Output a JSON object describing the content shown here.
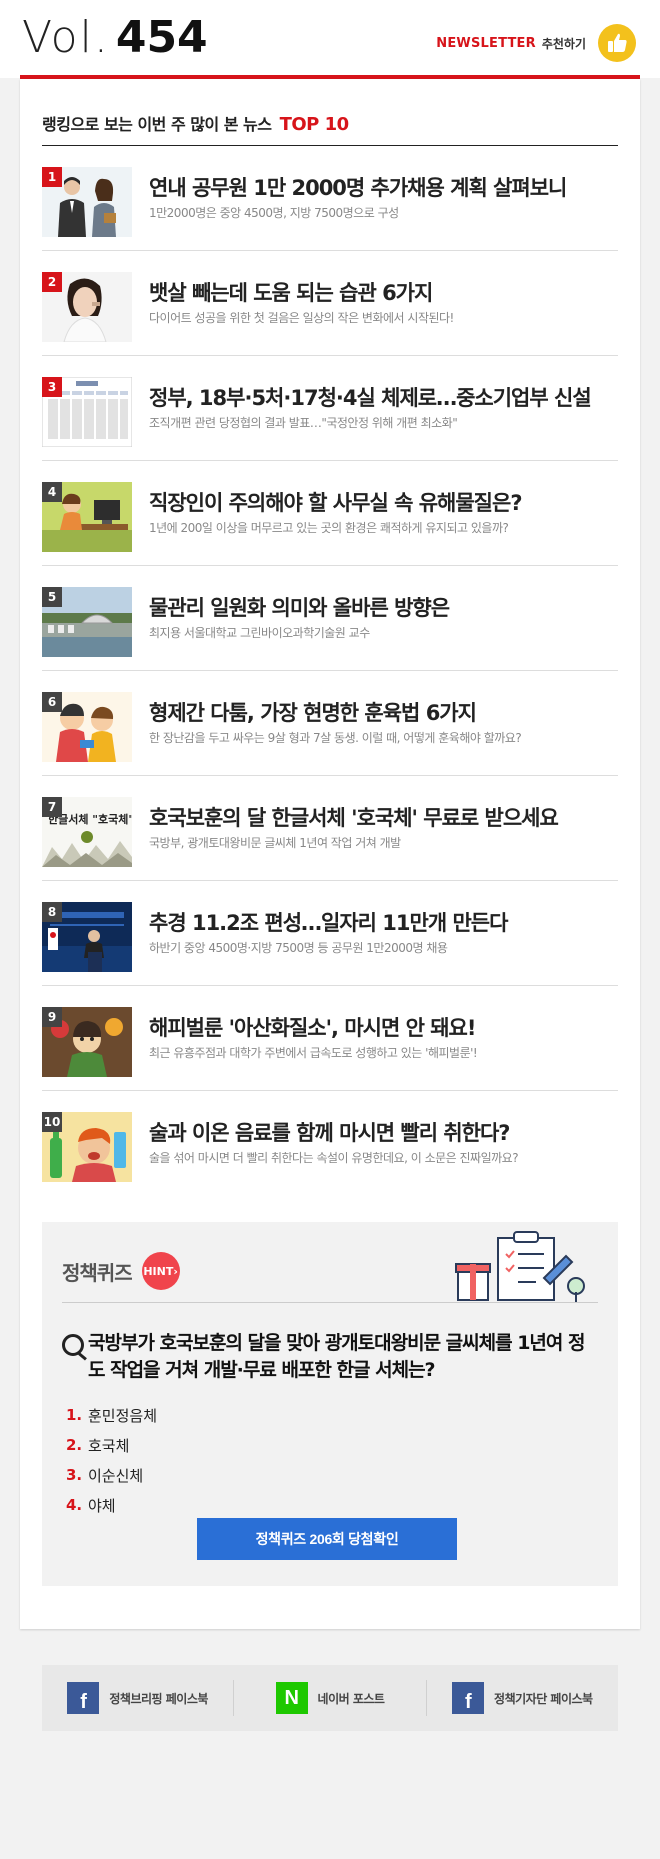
{
  "header": {
    "vol_prefix": "Vol.",
    "vol_number": "454",
    "newsletter_word": "NEWSLETTER",
    "recommend_label": "추천하기",
    "thumb_icon": "thumbs-up-icon"
  },
  "ranking": {
    "title": "랭킹으로 보는 이번 주 많이 본 뉴스",
    "title_accent": "TOP 10",
    "items": [
      {
        "rank": "1",
        "title": "연내 공무원 1만 2000명 추가채용 계획 살펴보니",
        "subtitle": "1만2000명은 중앙 4500명, 지방 7500명으로 구성"
      },
      {
        "rank": "2",
        "title": "뱃살 빼는데 도움 되는 습관 6가지",
        "subtitle": "다이어트 성공을 위한 첫 걸음은 일상의 작은 변화에서 시작된다!"
      },
      {
        "rank": "3",
        "title": "정부, 18부·5처·17청·4실 체제로…중소기업부 신설",
        "subtitle": "조직개편 관련 당정협의 결과 발표…\"국정안정 위해 개편 최소화\""
      },
      {
        "rank": "4",
        "title": "직장인이 주의해야 할 사무실 속 유해물질은?",
        "subtitle": "1년에 200일 이상을 머무르고 있는 곳의 환경은 쾌적하게 유지되고 있을까?"
      },
      {
        "rank": "5",
        "title": "물관리 일원화 의미와 올바른 방향은",
        "subtitle": "최지용 서울대학교 그린바이오과학기술원 교수"
      },
      {
        "rank": "6",
        "title": "형제간 다툼, 가장 현명한 훈육법 6가지",
        "subtitle": "한 장난감을 두고 싸우는 9살 형과 7살 동생. 이럴 때, 어떻게 훈육해야 할까요?"
      },
      {
        "rank": "7",
        "title": "호국보훈의 달 한글서체 '호국체' 무료로 받으세요",
        "subtitle": "국방부, 광개토대왕비문 글씨체 1년여 작업 거쳐 개발"
      },
      {
        "rank": "8",
        "title": "추경 11.2조 편성…일자리 11만개 만든다",
        "subtitle": "하반기 중앙 4500명·지방 7500명 등 공무원 1만2000명 채용"
      },
      {
        "rank": "9",
        "title": "해피벌룬 '아산화질소', 마시면 안 돼요!",
        "subtitle": "최근 유흥주점과 대학가 주변에서 급속도로 성행하고 있는 '해피벌룬'!"
      },
      {
        "rank": "10",
        "title": "술과 이온 음료를 함께 마시면 빨리 취한다?",
        "subtitle": "술을 섞어 마시면 더 빨리 취한다는 속설이 유명한데요, 이 소문은 진짜일까요?"
      }
    ],
    "thumb_7_text": "한글서체 \"호국체\""
  },
  "quiz": {
    "title": "정책퀴즈",
    "hint_label": "HINT",
    "question": "국방부가 호국보훈의 달을 맞아 광개토대왕비문 글씨체를 1년여 정도 작업을 거쳐 개발·무료 배포한 한글 서체는?",
    "options": [
      {
        "num": "1.",
        "label": "훈민정음체"
      },
      {
        "num": "2.",
        "label": "호국체"
      },
      {
        "num": "3.",
        "label": "이순신체"
      },
      {
        "num": "4.",
        "label": "야체"
      }
    ],
    "button_label": "정책퀴즈 206회 당첨확인"
  },
  "footer": {
    "links": [
      {
        "icon": "facebook-icon",
        "glyph": "f",
        "label": "정책브리핑 페이스북"
      },
      {
        "icon": "naver-icon",
        "glyph": "N",
        "label": "네이버 포스트"
      },
      {
        "icon": "facebook-icon",
        "glyph": "f",
        "label": "정책기자단 페이스북"
      }
    ]
  },
  "colors": {
    "accent_red": "#d7141a",
    "button_blue": "#2a6fd6",
    "facebook_blue": "#3b5998",
    "naver_green": "#1ec800",
    "thumb_yellow": "#f3c11c"
  }
}
